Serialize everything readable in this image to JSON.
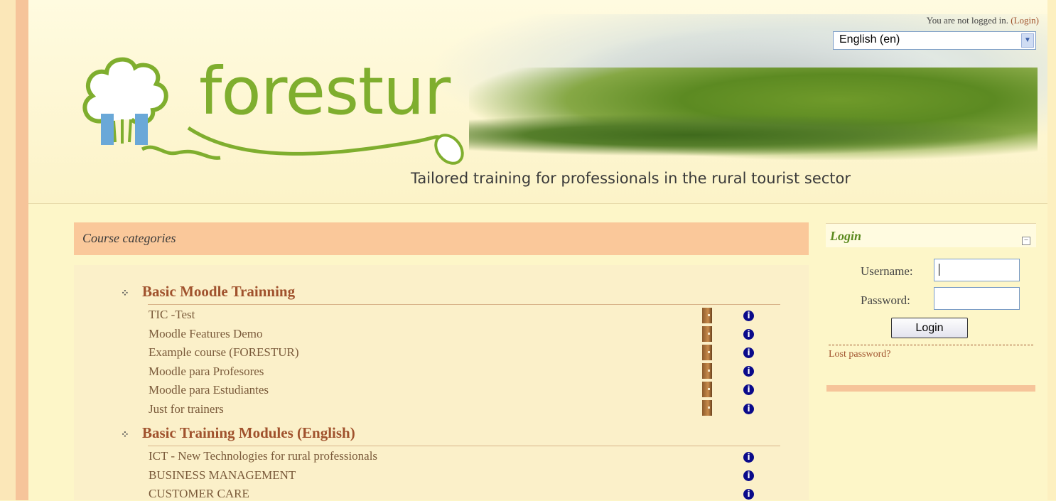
{
  "header": {
    "brand_name": "forestur",
    "tagline": "Tailored training for professionals in the rural tourist sector",
    "auth_status": "You are not logged in.",
    "login_link": "(Login)",
    "language_selected": "English (en)"
  },
  "categories_block": {
    "title": "Course categories",
    "categories": [
      {
        "name": "Basic Moodle Trainning",
        "courses": [
          "TIC -Test",
          "Moodle Features Demo",
          "Example course (FORESTUR)",
          "Moodle para Profesores",
          "Moodle para Estudiantes",
          "Just for trainers"
        ]
      },
      {
        "name": "Basic Training Modules (English)",
        "courses": [
          "ICT - New Technologies for rural professionals",
          "BUSINESS MANAGEMENT",
          "CUSTOMER CARE"
        ]
      }
    ]
  },
  "login_block": {
    "title": "Login",
    "username_label": "Username:",
    "password_label": "Password:",
    "username_value": "",
    "password_value": "",
    "button_label": "Login",
    "lost_password": "Lost password?"
  },
  "colors": {
    "page_bg": "#fdf6c8",
    "category_header_bg": "#fac89a",
    "link_brown": "#a0522d",
    "brand_green": "#7fae2e",
    "info_blue": "#0a0a8a"
  },
  "icons": {
    "guest_access": "door-icon",
    "course_info": "info-icon",
    "category": "category-icon",
    "collapse": "collapse-icon"
  }
}
